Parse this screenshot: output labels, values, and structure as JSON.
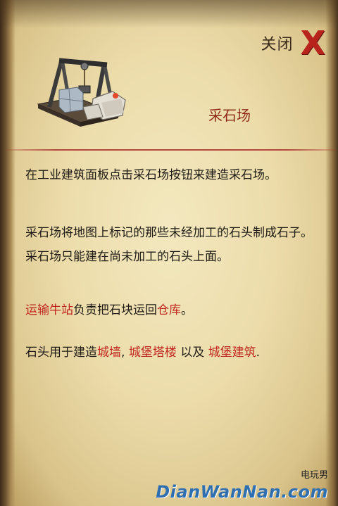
{
  "header": {
    "close_label": "关闭",
    "close_glyph": "X"
  },
  "building": {
    "title": "采石场",
    "icon": "stone-quarry-icon"
  },
  "paragraphs": {
    "p1": "在工业建筑面板点击采石场按钮来建造采石场。",
    "p2": "采石场将地图上标记的那些未经加工的石头制成石子。采石场只能建在尚未加工的石头上面。",
    "p3": {
      "link1": "运输牛站",
      "text1": "负责把石块运回",
      "link2": "仓库",
      "text2": "。"
    },
    "p4": {
      "text1": "石头用于建造",
      "link1": "城墙",
      "sep1": ", ",
      "link2": "城堡塔楼",
      "text2": " 以及 ",
      "link3": "城堡建筑",
      "text3": "."
    }
  },
  "watermark": {
    "small": "电玩男",
    "big": "DianWanNan.com"
  },
  "colors": {
    "highlight": "#c0261f",
    "close_x": "#b8231c",
    "title": "#8f2a1a",
    "parchment": "#ecdcaa"
  }
}
